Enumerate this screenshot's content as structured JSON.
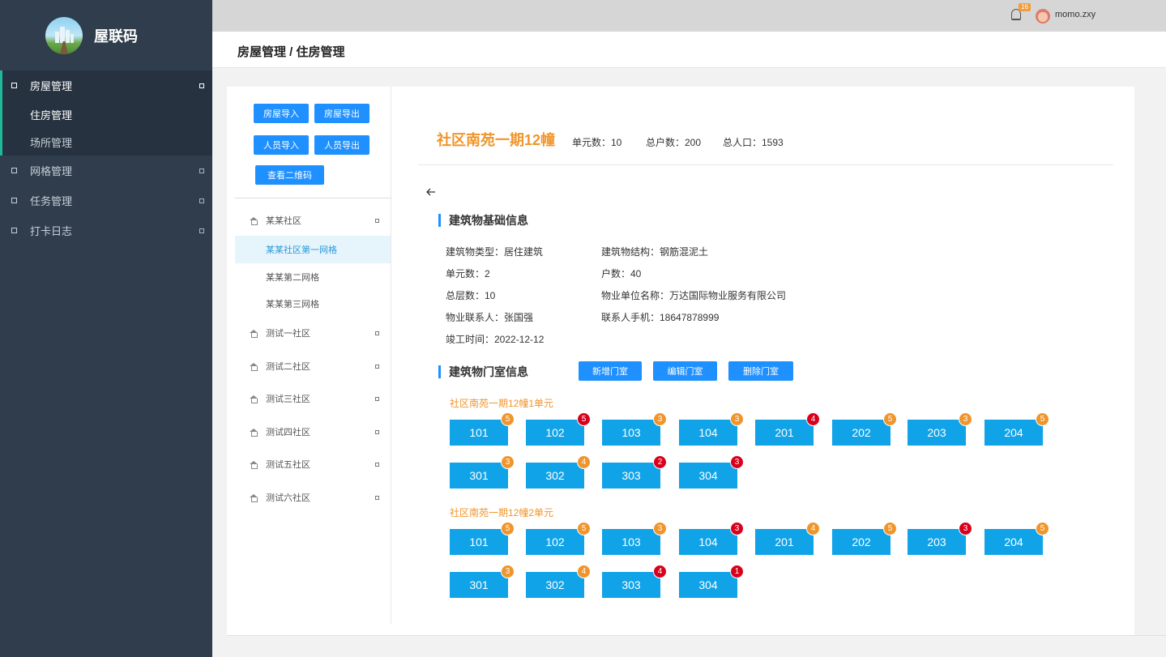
{
  "app": {
    "title": "屋联码"
  },
  "sidebar": {
    "items": [
      {
        "label": "房屋管理",
        "active": true,
        "children": [
          {
            "label": "住房管理"
          },
          {
            "label": "场所管理"
          }
        ]
      },
      {
        "label": "网格管理"
      },
      {
        "label": "任务管理"
      },
      {
        "label": "打卡日志"
      }
    ]
  },
  "topbar": {
    "notification_count": "16",
    "username": "momo.zxy"
  },
  "breadcrumb": "房屋管理 / 住房管理",
  "tree": {
    "buttons": [
      "房屋导入",
      "房屋导出",
      "人员导入",
      "人员导出",
      "查看二维码"
    ],
    "nodes": [
      {
        "label": "某某社区",
        "children": [
          "某某社区第一网格",
          "某某第二网格",
          "某某第三网格"
        ]
      },
      {
        "label": "测试一社区"
      },
      {
        "label": "测试二社区"
      },
      {
        "label": "测试三社区"
      },
      {
        "label": "测试四社区"
      },
      {
        "label": "测试五社区"
      },
      {
        "label": "测试六社区"
      }
    ],
    "selected": "某某社区第一网格"
  },
  "building": {
    "name": "社区南苑一期12幢",
    "stats": [
      "单元数：10",
      "总户数：200",
      "总人口：1593"
    ],
    "basic_title": "建筑物基础信息",
    "basic": [
      "建筑物类型：居住建筑",
      "建筑物结构：钢筋混泥土",
      "单元数：2",
      "户数：40",
      "总层数：10",
      "物业单位名称：万达国际物业服务有限公司",
      "物业联系人：张国强",
      "联系人手机：18647878999",
      "竣工时间：2022-12-12"
    ],
    "rooms_title": "建筑物门室信息",
    "room_buttons": [
      "新增门室",
      "编辑门室",
      "删除门室"
    ],
    "units": [
      {
        "title": "社区南苑一期12幢1单元",
        "rooms": [
          {
            "no": "101",
            "count": "5",
            "level": "orange"
          },
          {
            "no": "102",
            "count": "5",
            "level": "red"
          },
          {
            "no": "103",
            "count": "3",
            "level": "orange"
          },
          {
            "no": "104",
            "count": "3",
            "level": "orange"
          },
          {
            "no": "201",
            "count": "4",
            "level": "red"
          },
          {
            "no": "202",
            "count": "5",
            "level": "orange"
          },
          {
            "no": "203",
            "count": "3",
            "level": "orange"
          },
          {
            "no": "204",
            "count": "5",
            "level": "orange"
          },
          {
            "no": "301",
            "count": "3",
            "level": "orange"
          },
          {
            "no": "302",
            "count": "4",
            "level": "orange"
          },
          {
            "no": "303",
            "count": "2",
            "level": "red"
          },
          {
            "no": "304",
            "count": "3",
            "level": "red"
          }
        ]
      },
      {
        "title": "社区南苑一期12幢2单元",
        "rooms": [
          {
            "no": "101",
            "count": "5",
            "level": "orange"
          },
          {
            "no": "102",
            "count": "5",
            "level": "orange"
          },
          {
            "no": "103",
            "count": "3",
            "level": "orange"
          },
          {
            "no": "104",
            "count": "3",
            "level": "red"
          },
          {
            "no": "201",
            "count": "4",
            "level": "orange"
          },
          {
            "no": "202",
            "count": "5",
            "level": "orange"
          },
          {
            "no": "203",
            "count": "3",
            "level": "red"
          },
          {
            "no": "204",
            "count": "5",
            "level": "orange"
          },
          {
            "no": "301",
            "count": "3",
            "level": "orange"
          },
          {
            "no": "302",
            "count": "4",
            "level": "orange"
          },
          {
            "no": "303",
            "count": "4",
            "level": "red"
          },
          {
            "no": "304",
            "count": "1",
            "level": "red"
          }
        ]
      }
    ]
  },
  "colors": {
    "orange": "#f0952b",
    "red": "#d9001b",
    "room": "#11a3e8",
    "accent": "#1e90ff"
  }
}
